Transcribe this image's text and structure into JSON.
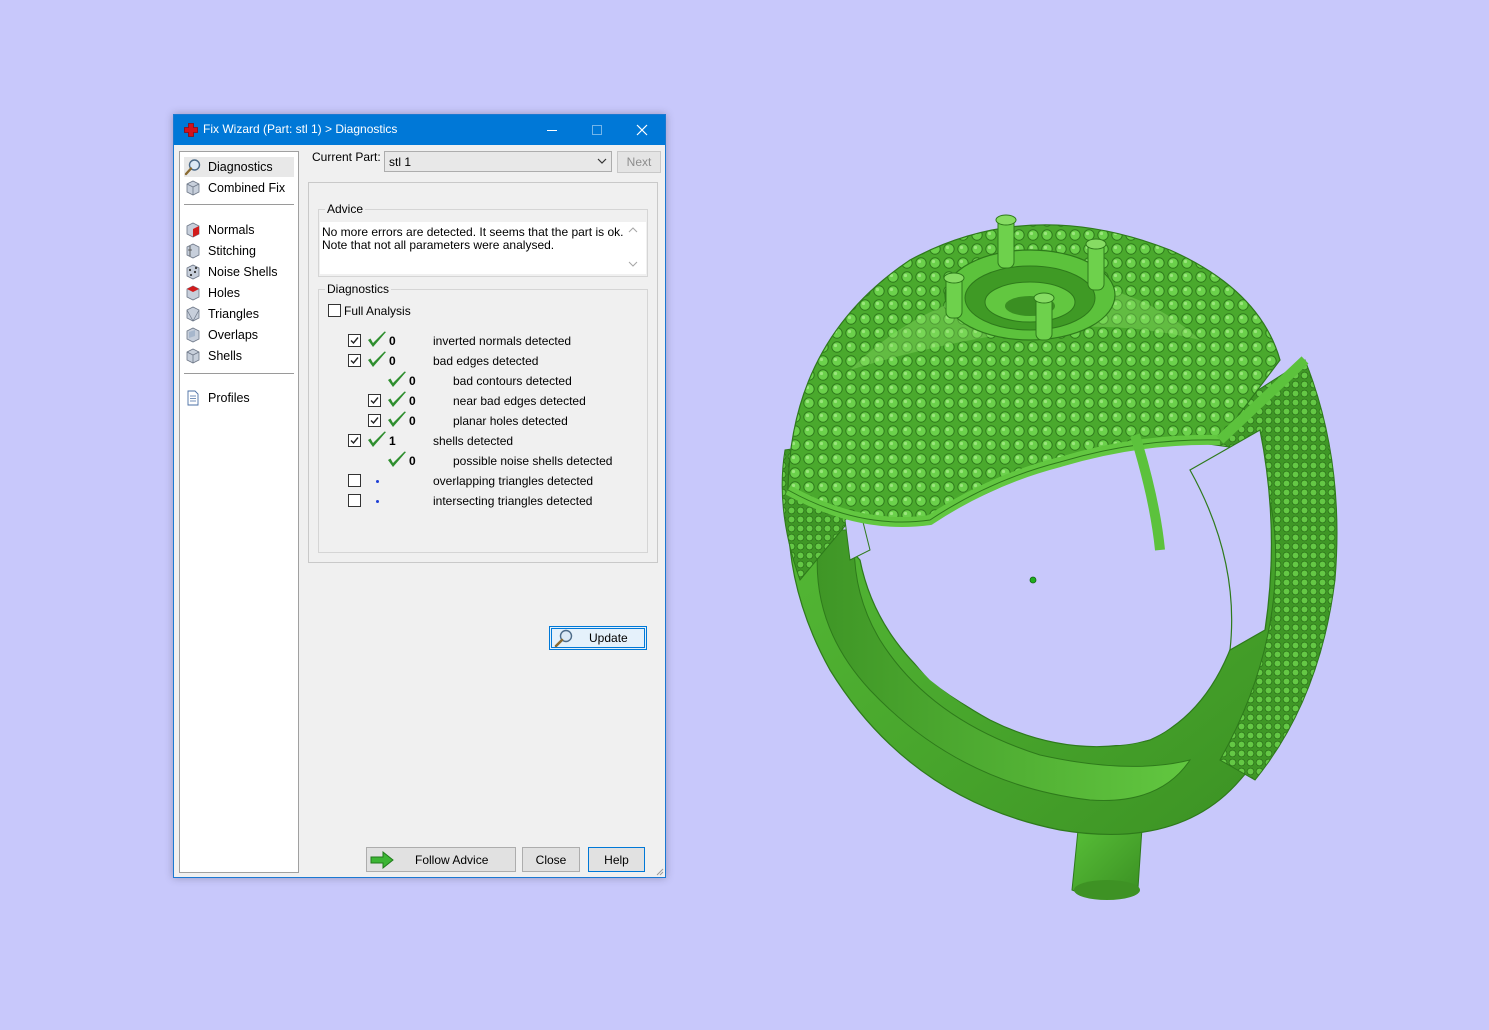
{
  "colors": {
    "background": "#c8c8fb",
    "titlebar": "#0078d7",
    "model_green": "#55c036",
    "check_green": "#2f8f2f"
  },
  "window": {
    "title": "Fix Wizard (Part: stl 1) > Diagnostics",
    "title_icon": "red-cross-icon"
  },
  "nav": {
    "items": [
      {
        "label": "Diagnostics",
        "icon": "magnifier-icon",
        "selected": true
      },
      {
        "label": "Combined Fix",
        "icon": "cube-icon"
      },
      {
        "label": "Normals",
        "icon": "normals-cube-icon"
      },
      {
        "label": "Stitching",
        "icon": "stitching-cube-icon"
      },
      {
        "label": "Noise Shells",
        "icon": "noise-cube-icon"
      },
      {
        "label": "Holes",
        "icon": "holes-cube-icon"
      },
      {
        "label": "Triangles",
        "icon": "triangles-cube-icon"
      },
      {
        "label": "Overlaps",
        "icon": "overlaps-cube-icon"
      },
      {
        "label": "Shells",
        "icon": "shells-cube-icon"
      },
      {
        "label": "Profiles",
        "icon": "document-icon"
      }
    ]
  },
  "current_part": {
    "label": "Current Part:",
    "value": "stl 1",
    "next_label": "Next"
  },
  "advice": {
    "legend": "Advice",
    "line1": "No more errors are detected. It seems that the part is ok.",
    "line2": "Note that not all parameters were analysed."
  },
  "diagnostics": {
    "legend": "Diagnostics",
    "full_analysis_label": "Full Analysis",
    "full_analysis_checked": false,
    "rows": [
      {
        "checked": true,
        "has_checkbox": true,
        "status": "ok",
        "count": "0",
        "label": "inverted normals detected",
        "indent": 0
      },
      {
        "checked": true,
        "has_checkbox": true,
        "status": "ok",
        "count": "0",
        "label": "bad edges detected",
        "indent": 0
      },
      {
        "checked": false,
        "has_checkbox": false,
        "status": "ok",
        "count": "0",
        "label": "bad contours detected",
        "indent": 1
      },
      {
        "checked": true,
        "has_checkbox": true,
        "status": "ok",
        "count": "0",
        "label": "near bad edges detected",
        "indent": 1
      },
      {
        "checked": true,
        "has_checkbox": true,
        "status": "ok",
        "count": "0",
        "label": "planar holes detected",
        "indent": 1
      },
      {
        "checked": true,
        "has_checkbox": true,
        "status": "ok",
        "count": "1",
        "label": "shells detected",
        "indent": 0
      },
      {
        "checked": false,
        "has_checkbox": false,
        "status": "ok",
        "count": "0",
        "label": "possible noise shells detected",
        "indent": 1
      },
      {
        "checked": false,
        "has_checkbox": true,
        "status": "pending",
        "count": "",
        "label": "overlapping triangles detected",
        "indent": 0
      },
      {
        "checked": false,
        "has_checkbox": true,
        "status": "pending",
        "count": "",
        "label": "intersecting triangles detected",
        "indent": 0
      }
    ],
    "update_label": "Update"
  },
  "footer": {
    "follow_label": "Follow Advice",
    "close_label": "Close",
    "help_label": "Help"
  }
}
